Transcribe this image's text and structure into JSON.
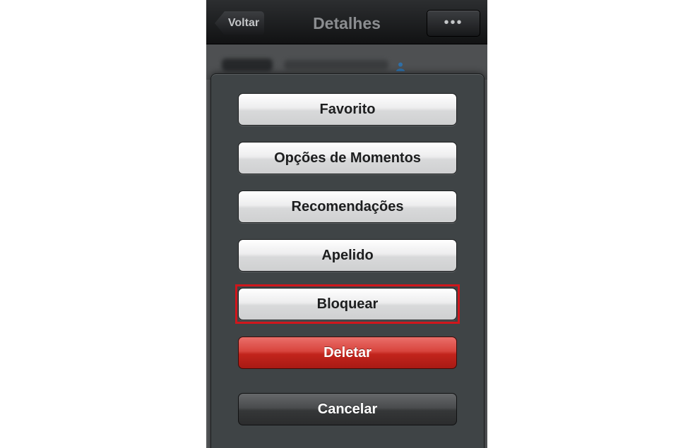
{
  "navbar": {
    "back_label": "Voltar",
    "title": "Detalhes",
    "more_label": "•••"
  },
  "contact": {
    "icon": "person-icon"
  },
  "action_sheet": {
    "buttons": [
      {
        "label": "Favorito",
        "style": "light"
      },
      {
        "label": "Opções de Momentos",
        "style": "light"
      },
      {
        "label": "Recomendações",
        "style": "light"
      },
      {
        "label": "Apelido",
        "style": "light"
      },
      {
        "label": "Bloquear",
        "style": "light",
        "highlighted": true
      },
      {
        "label": "Deletar",
        "style": "destructive"
      },
      {
        "label": "Cancelar",
        "style": "cancel"
      }
    ]
  },
  "colors": {
    "highlight": "#d0161c",
    "destructive": "#c2241c",
    "sheet_bg": "#3f4446",
    "navbar_bg": "#1c1d1f"
  }
}
